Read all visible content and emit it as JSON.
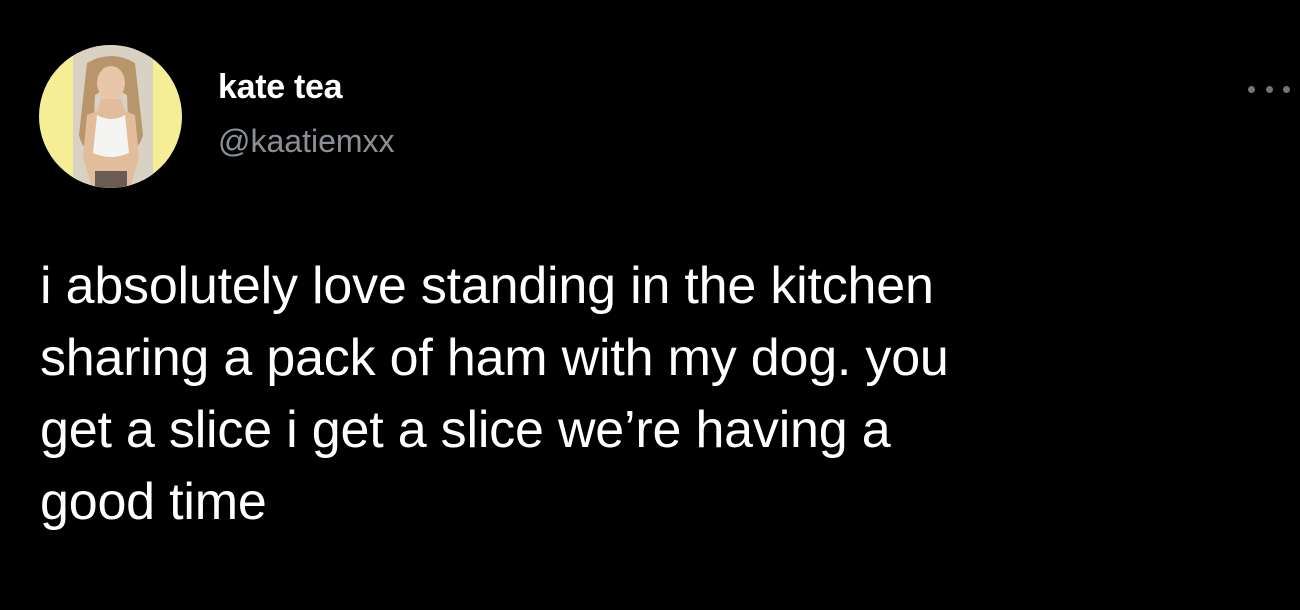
{
  "author": {
    "display_name": "kate tea",
    "handle": "@kaatiemxx",
    "avatar_bg": "#f6ee96"
  },
  "menu": {
    "icon": "more-horizontal-icon"
  },
  "tweet": {
    "text": "i absolutely love standing in the kitchen\nsharing a pack of ham with my dog. you\nget a slice i get a slice we’re having a\ngood time"
  },
  "colors": {
    "background": "#000000",
    "text": "#ffffff",
    "handle": "#8b9096",
    "icon": "#6e767d"
  }
}
